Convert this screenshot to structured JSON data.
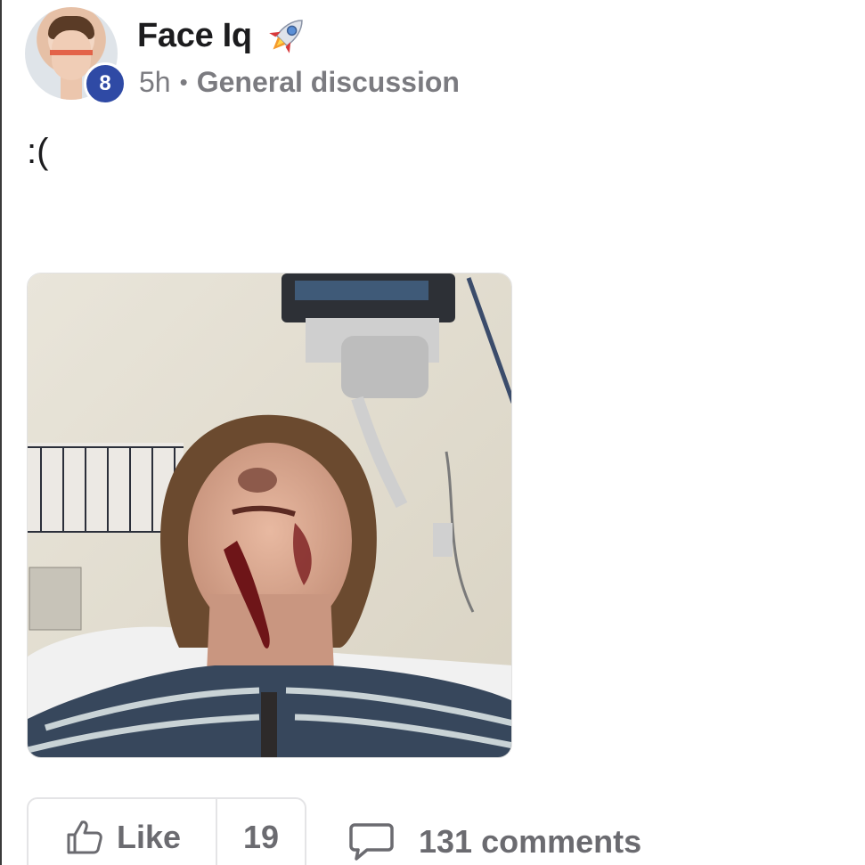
{
  "post": {
    "author_name": "Face Iq",
    "author_emoji": "rocket-icon",
    "badge_count": "8",
    "time_ago": "5h",
    "separator": "•",
    "group_name": "General discussion",
    "body_text": ":(",
    "photo_subject": "hospital-selfie-photo"
  },
  "actions": {
    "like_label": "Like",
    "like_count": "19",
    "comments_label": "131 comments"
  },
  "colors": {
    "badge": "#2f4aa5",
    "meta_text": "#7b7b80",
    "action_text": "#6b6b70",
    "border": "#e4e4e6"
  }
}
